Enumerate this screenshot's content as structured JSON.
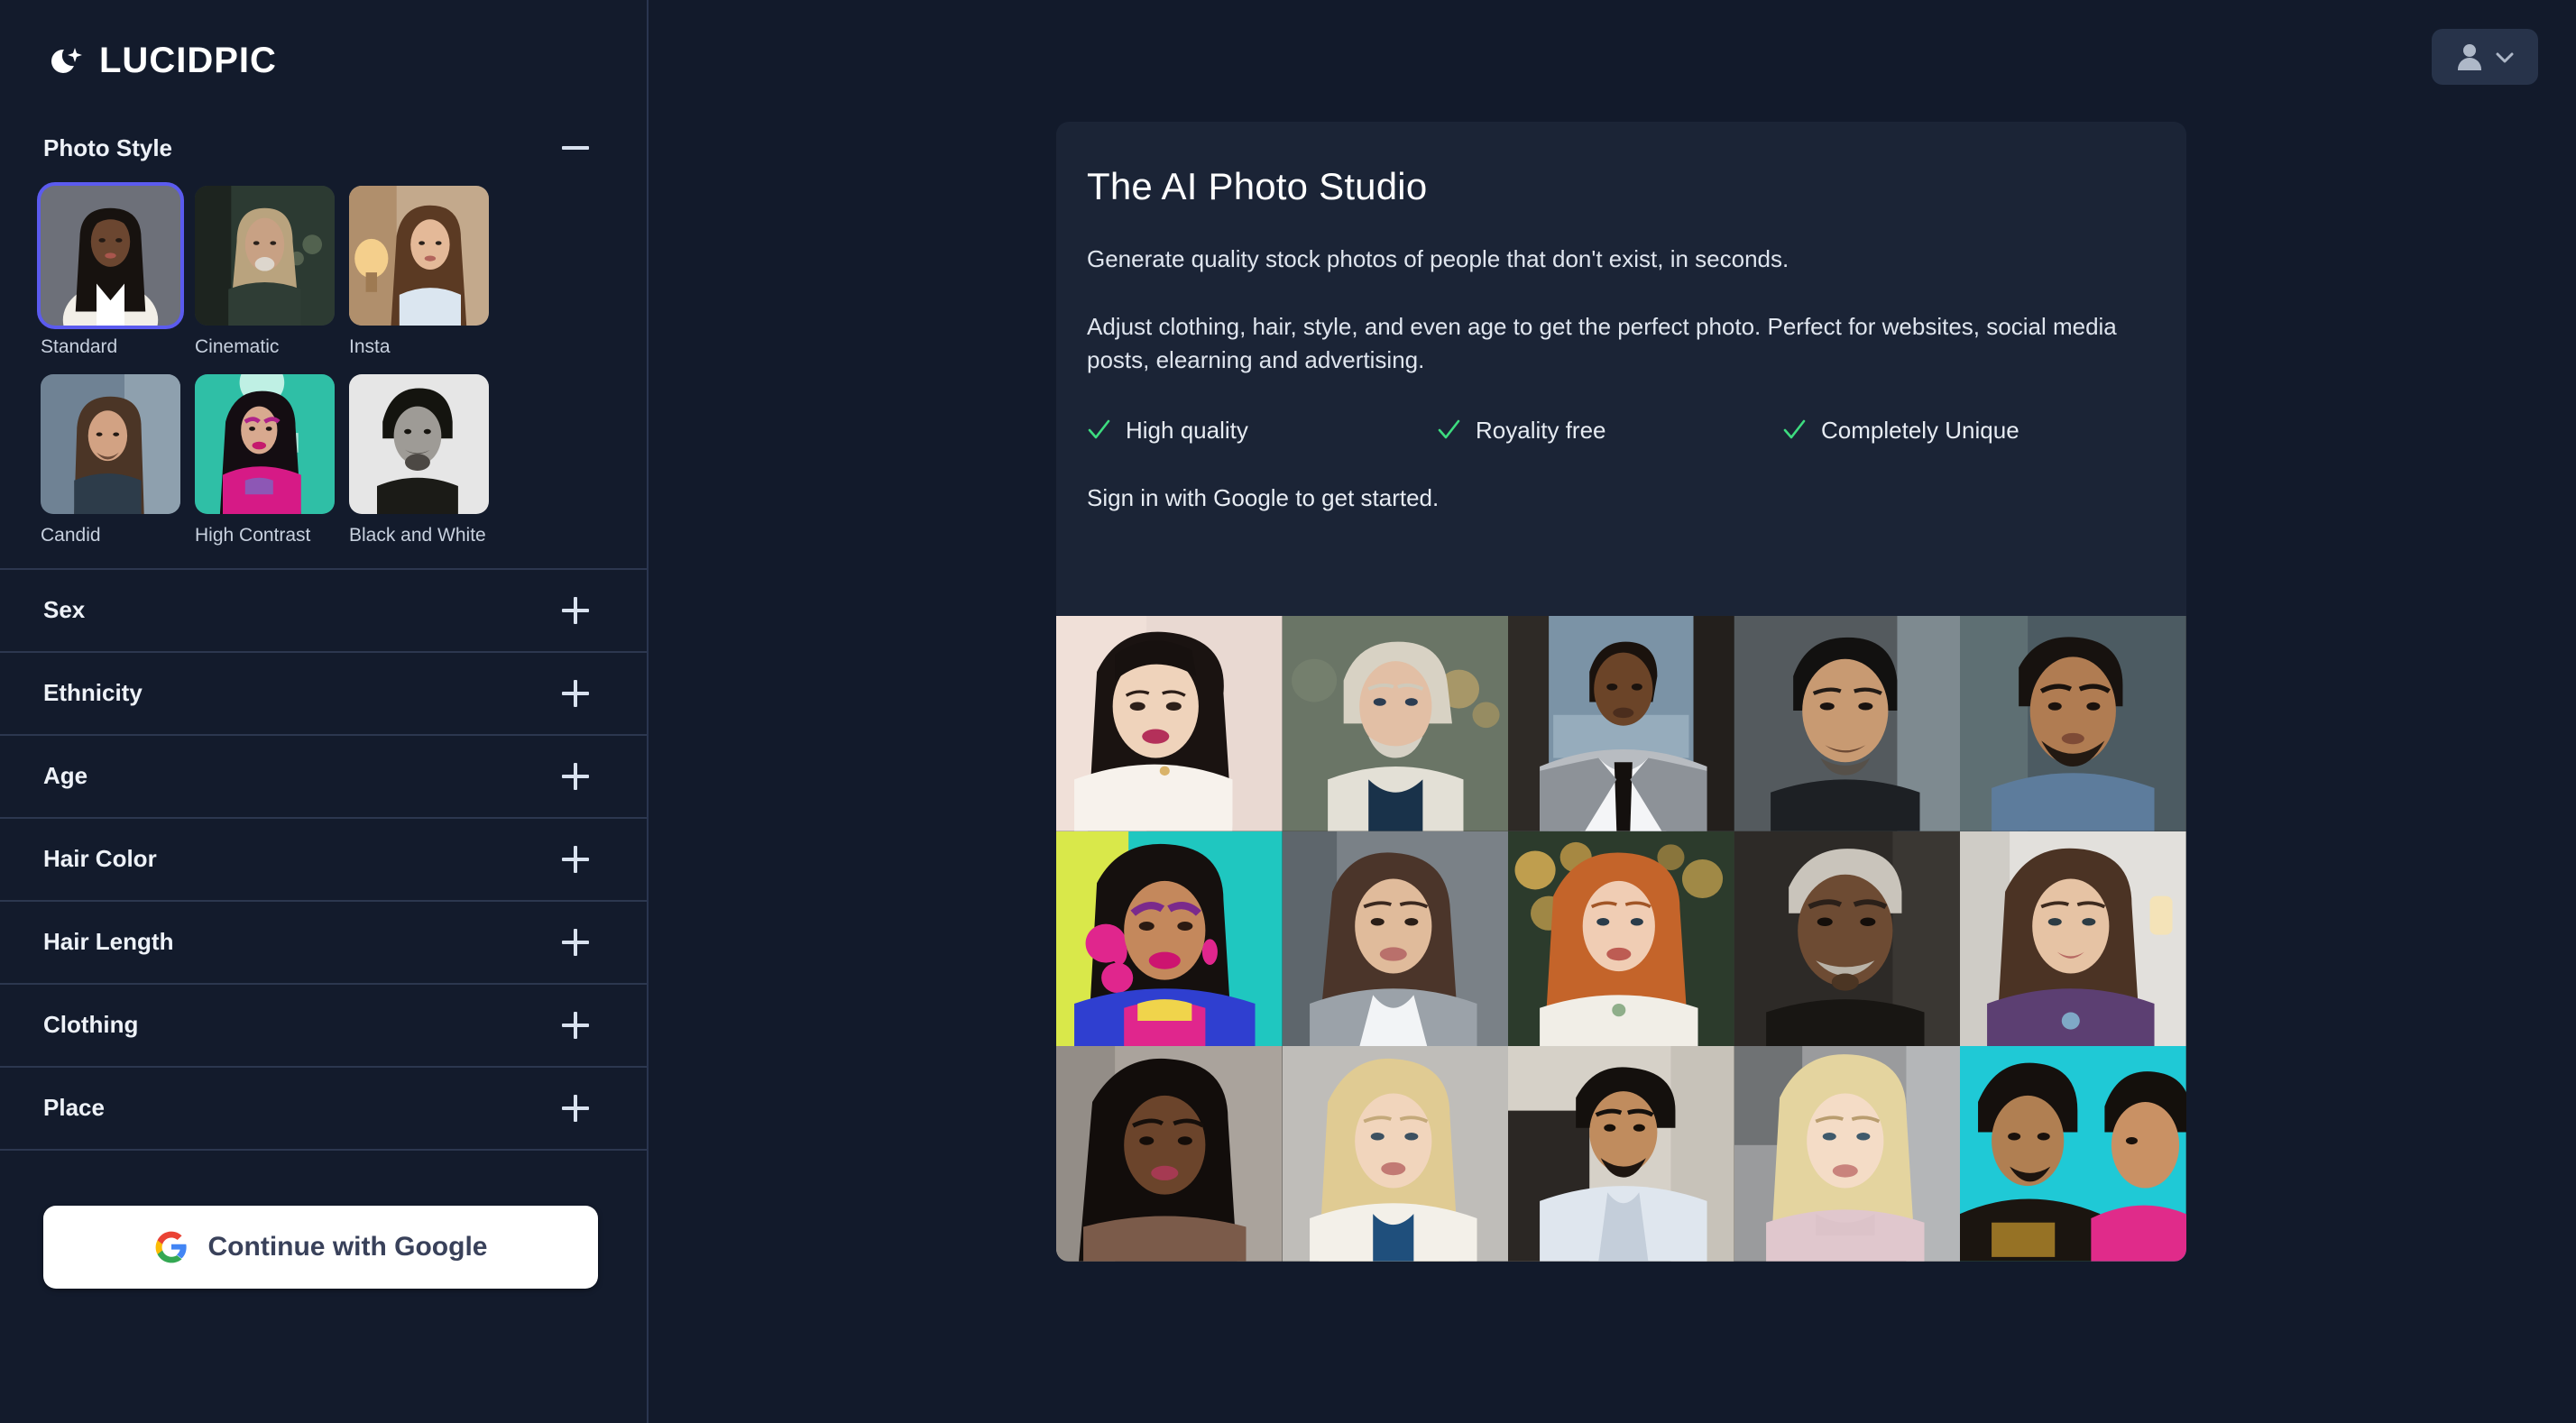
{
  "brand": {
    "name": "LUCIDPIC",
    "icon": "moon-sparkle-icon"
  },
  "topbar": {
    "user_icon": "user-avatar-icon",
    "chevron_icon": "chevron-down-icon"
  },
  "sidebar": {
    "photo_style": {
      "title": "Photo Style",
      "collapse_icon": "minus-icon",
      "selected": "Standard",
      "options": [
        {
          "label": "Standard",
          "selected": true
        },
        {
          "label": "Cinematic",
          "selected": false
        },
        {
          "label": "Insta",
          "selected": false
        },
        {
          "label": "Candid",
          "selected": false
        },
        {
          "label": "High Contrast",
          "selected": false
        },
        {
          "label": "Black and White",
          "selected": false
        }
      ]
    },
    "sections": [
      {
        "label": "Sex",
        "expand_icon": "plus-icon",
        "expanded": false
      },
      {
        "label": "Ethnicity",
        "expand_icon": "plus-icon",
        "expanded": false
      },
      {
        "label": "Age",
        "expand_icon": "plus-icon",
        "expanded": false
      },
      {
        "label": "Hair Color",
        "expand_icon": "plus-icon",
        "expanded": false
      },
      {
        "label": "Hair Length",
        "expand_icon": "plus-icon",
        "expanded": false
      },
      {
        "label": "Clothing",
        "expand_icon": "plus-icon",
        "expanded": false
      },
      {
        "label": "Place",
        "expand_icon": "plus-icon",
        "expanded": false
      }
    ],
    "google_button": {
      "label": "Continue with Google",
      "icon": "google-g-icon"
    }
  },
  "main": {
    "card": {
      "title": "The AI Photo Studio",
      "paragraph1": "Generate quality stock photos of people that don't exist, in seconds.",
      "paragraph2": "Adjust clothing, hair, style, and even age to get the perfect photo. Perfect for websites, social media posts, elearning and advertising.",
      "features": [
        {
          "label": "High quality",
          "icon": "check-icon"
        },
        {
          "label": "Royality free",
          "icon": "check-icon"
        },
        {
          "label": "Completely Unique",
          "icon": "check-icon"
        }
      ],
      "signin_text": "Sign in with Google to get started.",
      "gallery": {
        "rows": 3,
        "cols": 5,
        "items": [
          {
            "alt": "asian-woman-white-lace-portrait"
          },
          {
            "alt": "older-white-man-beard-cream-jacket"
          },
          {
            "alt": "black-man-grey-suit-black-tie"
          },
          {
            "alt": "older-asian-man-dark-jacket"
          },
          {
            "alt": "south-asian-man-denim-shirt"
          },
          {
            "alt": "south-asian-woman-pink-makeup-teal-bg"
          },
          {
            "alt": "asian-woman-grey-blazer"
          },
          {
            "alt": "red-haired-woman-white-blouse-bokeh"
          },
          {
            "alt": "older-black-man-moustache"
          },
          {
            "alt": "brunette-woman-purple-top-indoors"
          },
          {
            "alt": "black-woman-curly-hair-studio"
          },
          {
            "alt": "blonde-woman-white-cardigan"
          },
          {
            "alt": "middle-eastern-man-light-blue-shirt"
          },
          {
            "alt": "blonde-woman-pink-turtleneck"
          },
          {
            "alt": "two-men-embroidered-jacket-teal-bg"
          }
        ]
      }
    }
  },
  "colors": {
    "page_bg": "#121a2b",
    "sidebar_bg": "#131b2c",
    "card_bg": "#1b2436",
    "accent_selected": "#5b5bef",
    "check_green": "#3ddc7f",
    "divider": "#2c374f",
    "text_primary": "#eef2f8",
    "google_btn_bg": "#ffffff"
  }
}
